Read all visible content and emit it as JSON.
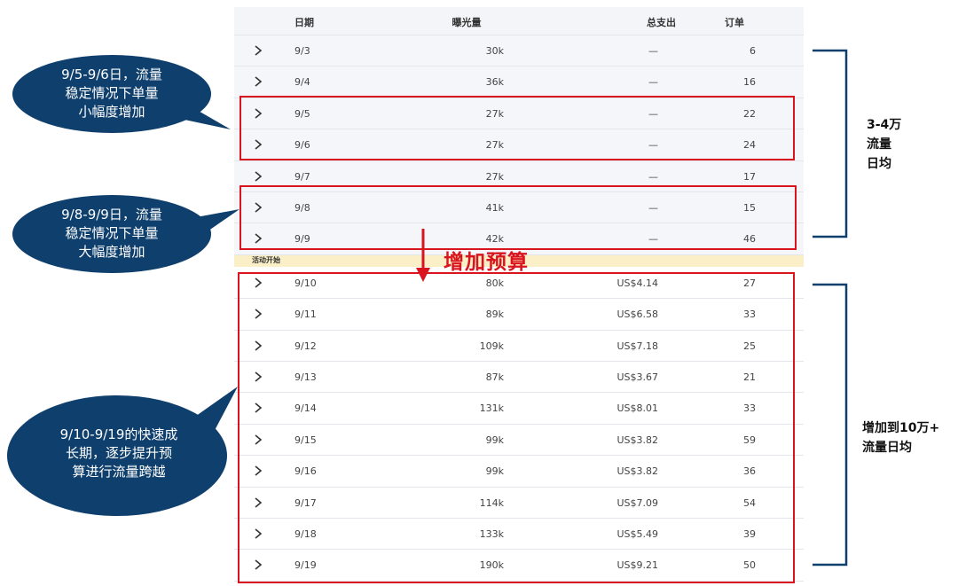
{
  "table": {
    "headers": {
      "date": "日期",
      "impressions": "曝光量",
      "spend": "总支出",
      "orders": "订单"
    },
    "activity_label": "活动开始",
    "rows": [
      {
        "date": "9/3",
        "impressions": "30k",
        "spend": "—",
        "orders": "6"
      },
      {
        "date": "9/4",
        "impressions": "36k",
        "spend": "—",
        "orders": "16"
      },
      {
        "date": "9/5",
        "impressions": "27k",
        "spend": "—",
        "orders": "22"
      },
      {
        "date": "9/6",
        "impressions": "27k",
        "spend": "—",
        "orders": "24"
      },
      {
        "date": "9/7",
        "impressions": "27k",
        "spend": "—",
        "orders": "17"
      },
      {
        "date": "9/8",
        "impressions": "41k",
        "spend": "—",
        "orders": "15"
      },
      {
        "date": "9/9",
        "impressions": "42k",
        "spend": "—",
        "orders": "46"
      },
      {
        "date": "9/10",
        "impressions": "80k",
        "spend": "US$4.14",
        "orders": "27"
      },
      {
        "date": "9/11",
        "impressions": "89k",
        "spend": "US$6.58",
        "orders": "33"
      },
      {
        "date": "9/12",
        "impressions": "109k",
        "spend": "US$7.18",
        "orders": "25"
      },
      {
        "date": "9/13",
        "impressions": "87k",
        "spend": "US$3.67",
        "orders": "21"
      },
      {
        "date": "9/14",
        "impressions": "131k",
        "spend": "US$8.01",
        "orders": "33"
      },
      {
        "date": "9/15",
        "impressions": "99k",
        "spend": "US$3.82",
        "orders": "59"
      },
      {
        "date": "9/16",
        "impressions": "99k",
        "spend": "US$3.82",
        "orders": "36"
      },
      {
        "date": "9/17",
        "impressions": "114k",
        "spend": "US$7.09",
        "orders": "54"
      },
      {
        "date": "9/18",
        "impressions": "133k",
        "spend": "US$5.49",
        "orders": "39"
      },
      {
        "date": "9/19",
        "impressions": "190k",
        "spend": "US$9.21",
        "orders": "50"
      }
    ]
  },
  "annotations": {
    "budget_label": "增加预算",
    "callout_1": {
      "line1": "9/5-9/6日，流量",
      "line2": "稳定情况下单量",
      "line3": "小幅度增加"
    },
    "callout_2": {
      "line1": "9/8-9/9日，流量",
      "line2": "稳定情况下单量",
      "line3": "大幅度增加"
    },
    "callout_3": {
      "line1": "9/10-9/19的快速成",
      "line2": "长期，逐步提升预",
      "line3": "算进行流量跨越"
    },
    "bracket_note_1": {
      "line1": "3-4万",
      "line2": "流量",
      "line3": "日均"
    },
    "bracket_note_2": {
      "line1": "增加到10万+",
      "line2": "流量日均"
    }
  },
  "colors": {
    "callout_fill": "#0f3f6c",
    "highlight_red": "#d9141e",
    "bracket_navy": "#0f3f6c",
    "activity_band": "#fbefc7"
  }
}
